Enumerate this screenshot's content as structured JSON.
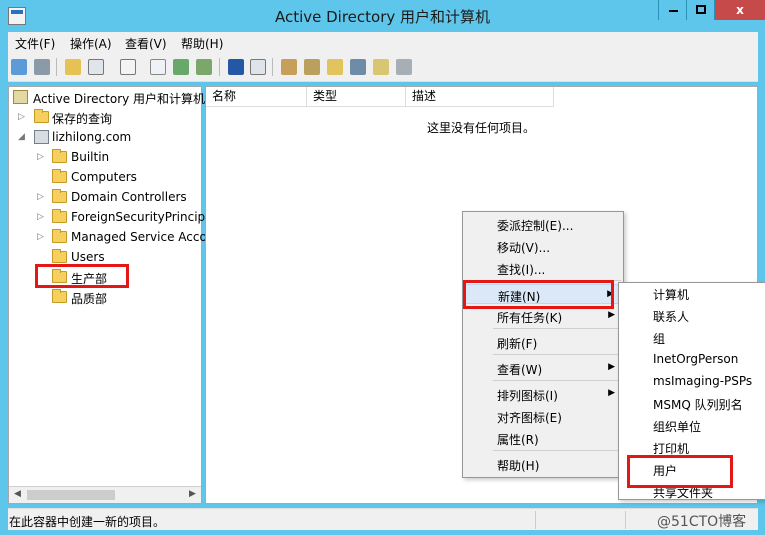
{
  "window": {
    "title": "Active Directory 用户和计算机",
    "close_symbol": "x"
  },
  "menubar": {
    "items": [
      "文件(F)",
      "操作(A)",
      "查看(V)",
      "帮助(H)"
    ]
  },
  "tree": {
    "root_label": "Active Directory 用户和计算机",
    "saved_queries": "保存的查询",
    "domain": "lizhilong.com",
    "children": [
      "Builtin",
      "Computers",
      "Domain Controllers",
      "ForeignSecurityPrincipa",
      "Managed Service Acco",
      "Users",
      "生产部",
      "品质部"
    ]
  },
  "list": {
    "columns": [
      "名称",
      "类型",
      "描述"
    ],
    "empty_message": "这里没有任何项目。"
  },
  "context_menu": {
    "items": [
      "委派控制(E)...",
      "移动(V)...",
      "查找(I)...",
      "新建(N)",
      "所有任务(K)",
      "刷新(F)",
      "查看(W)",
      "排列图标(I)",
      "对齐图标(E)",
      "属性(R)",
      "帮助(H)"
    ],
    "submenu_items": [
      "计算机",
      "联系人",
      "组",
      "InetOrgPerson",
      "msImaging-PSPs",
      "MSMQ 队列别名",
      "组织单位",
      "打印机",
      "用户",
      "共享文件夹"
    ]
  },
  "statusbar": {
    "text": "在此容器中创建一新的项目。"
  },
  "watermark": "@51CTO博客",
  "colors": {
    "titlebar": "#5ec6ea",
    "highlight_box": "#e51616",
    "selection": "#dbe8f8"
  }
}
